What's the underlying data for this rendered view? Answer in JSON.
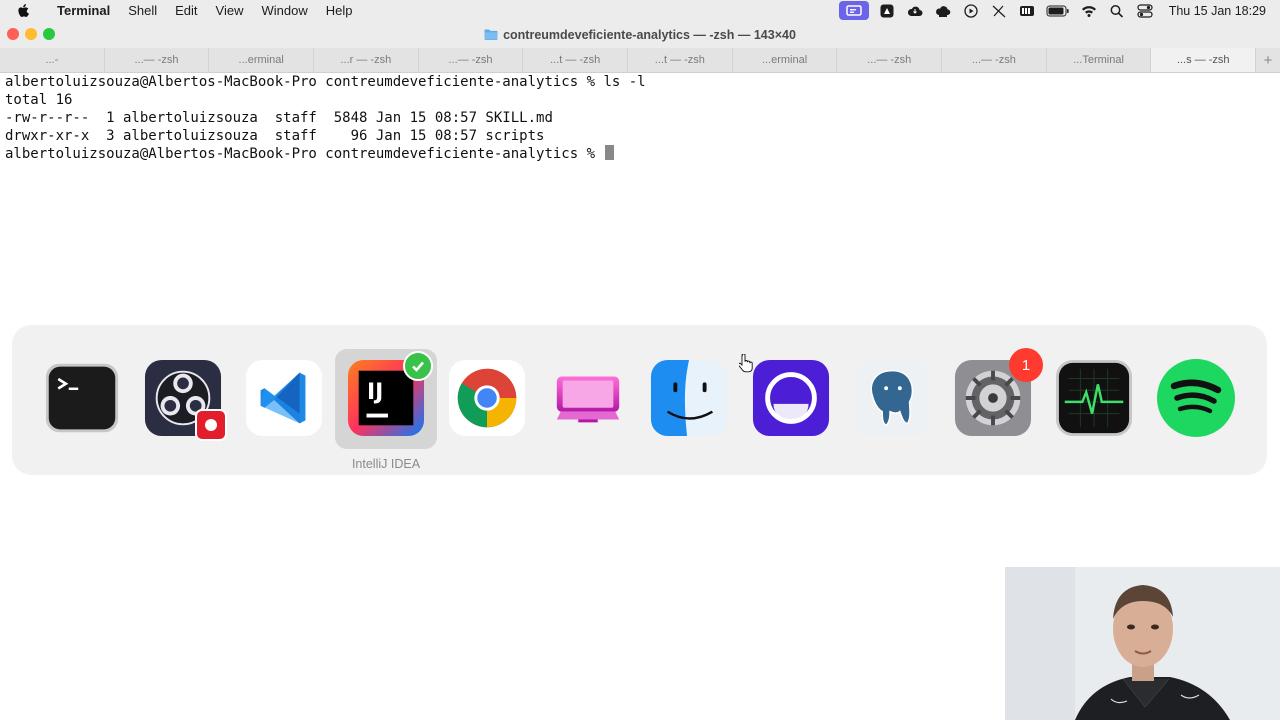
{
  "menubar": {
    "app_name": "Terminal",
    "items": [
      "Shell",
      "Edit",
      "View",
      "Window",
      "Help"
    ],
    "clock": "Thu 15 Jan  18:29",
    "status_icons": [
      "screen-share-icon",
      "app-indicator-icon",
      "cloud-icon",
      "cloud-sync-icon",
      "play-icon",
      "pen-icon",
      "keyboard-icon",
      "battery-icon",
      "wifi-icon",
      "search-icon",
      "control-center-icon"
    ]
  },
  "window": {
    "title": "contreumdeveficiente-analytics — -zsh — 143×40"
  },
  "tabs": [
    {
      "label": "...-"
    },
    {
      "label": "...— -zsh"
    },
    {
      "label": "...erminal"
    },
    {
      "label": "...r — -zsh"
    },
    {
      "label": "...— -zsh"
    },
    {
      "label": "...t — -zsh"
    },
    {
      "label": "...t — -zsh"
    },
    {
      "label": "...erminal"
    },
    {
      "label": "...— -zsh"
    },
    {
      "label": "...— -zsh"
    },
    {
      "label": "...Terminal"
    },
    {
      "label": "...s — -zsh"
    }
  ],
  "terminal": {
    "lines": [
      "albertoluizsouza@Albertos-MacBook-Pro contreumdeveficiente-analytics % ls -l",
      "total 16",
      "-rw-r--r--  1 albertoluizsouza  staff  5848 Jan 15 08:57 SKILL.md",
      "drwxr-xr-x  3 albertoluizsouza  staff    96 Jan 15 08:57 scripts",
      "albertoluizsouza@Albertos-MacBook-Pro contreumdeveficiente-analytics % "
    ]
  },
  "switcher": {
    "selected_label": "IntelliJ IDEA",
    "apps": [
      {
        "icon": "terminal-icon"
      },
      {
        "icon": "obs-icon"
      },
      {
        "icon": "vscode-icon"
      },
      {
        "icon": "intellij-icon",
        "badge": "check"
      },
      {
        "icon": "chrome-icon"
      },
      {
        "icon": "cleanmymac-icon"
      },
      {
        "icon": "finder-icon"
      },
      {
        "icon": "screen-recorder-icon"
      },
      {
        "icon": "pgadmin-icon"
      },
      {
        "icon": "system-settings-icon",
        "badge": "1"
      },
      {
        "icon": "activity-monitor-icon"
      },
      {
        "icon": "spotify-icon"
      }
    ],
    "intellij_text": "IJ",
    "settings_badge": "1"
  }
}
